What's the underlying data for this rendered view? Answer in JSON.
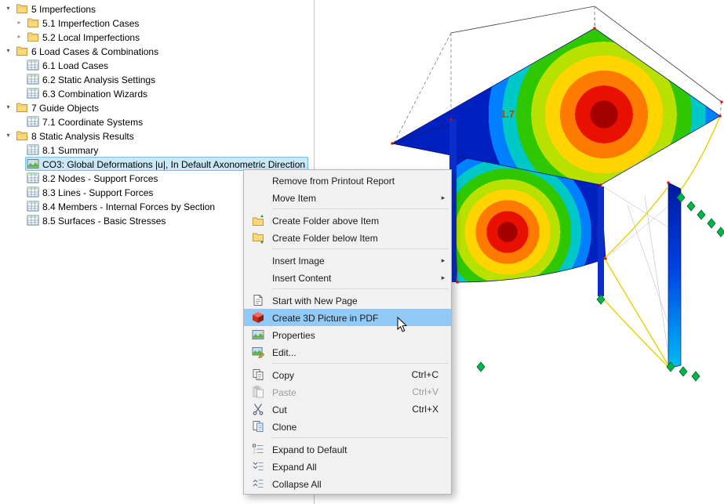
{
  "tree": {
    "items": [
      {
        "label": "5 Imperfections",
        "level": 0,
        "icon": "folder",
        "chevron": "down"
      },
      {
        "label": "5.1 Imperfection Cases",
        "level": 1,
        "icon": "folder",
        "chevron": "right"
      },
      {
        "label": "5.2 Local Imperfections",
        "level": 1,
        "icon": "folder",
        "chevron": "right"
      },
      {
        "label": "6 Load Cases & Combinations",
        "level": 0,
        "icon": "folder",
        "chevron": "down"
      },
      {
        "label": "6.1 Load Cases",
        "level": 1,
        "icon": "table",
        "chevron": "none"
      },
      {
        "label": "6.2 Static Analysis Settings",
        "level": 1,
        "icon": "table",
        "chevron": "none"
      },
      {
        "label": "6.3 Combination Wizards",
        "level": 1,
        "icon": "table",
        "chevron": "none"
      },
      {
        "label": "7 Guide Objects",
        "level": 0,
        "icon": "folder",
        "chevron": "down"
      },
      {
        "label": "7.1 Coordinate Systems",
        "level": 1,
        "icon": "table",
        "chevron": "none"
      },
      {
        "label": "8 Static Analysis Results",
        "level": 0,
        "icon": "folder",
        "chevron": "down"
      },
      {
        "label": "8.1 Summary",
        "level": 1,
        "icon": "table",
        "chevron": "none"
      },
      {
        "label": "CO3: Global Deformations |u|, In Default Axonometric Direction",
        "level": 1,
        "icon": "image",
        "chevron": "none",
        "selected": true
      },
      {
        "label": "8.2 Nodes - Support Forces",
        "level": 1,
        "icon": "table",
        "chevron": "none"
      },
      {
        "label": "8.3 Lines - Support Forces",
        "level": 1,
        "icon": "table",
        "chevron": "none"
      },
      {
        "label": "8.4 Members - Internal Forces by Section",
        "level": 1,
        "icon": "table",
        "chevron": "none"
      },
      {
        "label": "8.5 Surfaces - Basic Stresses",
        "level": 1,
        "icon": "table",
        "chevron": "none"
      }
    ]
  },
  "context_menu": {
    "items": [
      {
        "label": "Remove from Printout Report",
        "icon": "none"
      },
      {
        "label": "Move Item",
        "icon": "none",
        "submenu": true
      },
      {
        "separator": true
      },
      {
        "label": "Create Folder above Item",
        "icon": "folder-above"
      },
      {
        "label": "Create Folder below Item",
        "icon": "folder-below"
      },
      {
        "separator": true
      },
      {
        "label": "Insert Image",
        "icon": "none",
        "submenu": true
      },
      {
        "label": "Insert Content",
        "icon": "none",
        "submenu": true
      },
      {
        "separator": true
      },
      {
        "label": "Start with New Page",
        "icon": "new-page"
      },
      {
        "label": "Create 3D Picture in PDF",
        "icon": "cube-3d",
        "highlighted": true
      },
      {
        "label": "Properties",
        "icon": "properties"
      },
      {
        "label": "Edit...",
        "icon": "edit"
      },
      {
        "separator": true
      },
      {
        "label": "Copy",
        "icon": "copy",
        "shortcut": "Ctrl+C"
      },
      {
        "label": "Paste",
        "icon": "paste",
        "shortcut": "Ctrl+V",
        "disabled": true
      },
      {
        "label": "Cut",
        "icon": "cut",
        "shortcut": "Ctrl+X"
      },
      {
        "label": "Clone",
        "icon": "clone"
      },
      {
        "separator": true
      },
      {
        "label": "Expand to Default",
        "icon": "expand-default"
      },
      {
        "label": "Expand All",
        "icon": "expand-all"
      },
      {
        "label": "Collapse All",
        "icon": "collapse-all"
      }
    ]
  },
  "viewport": {
    "deformation_label": "1.7",
    "contour_palette": [
      "#a50000",
      "#e81000",
      "#ff7a00",
      "#ffd400",
      "#b8e000",
      "#2fc800",
      "#00c8c8",
      "#0080ff",
      "#0020c0"
    ],
    "support_color": "#00b44a",
    "node_color": "#e80000"
  }
}
